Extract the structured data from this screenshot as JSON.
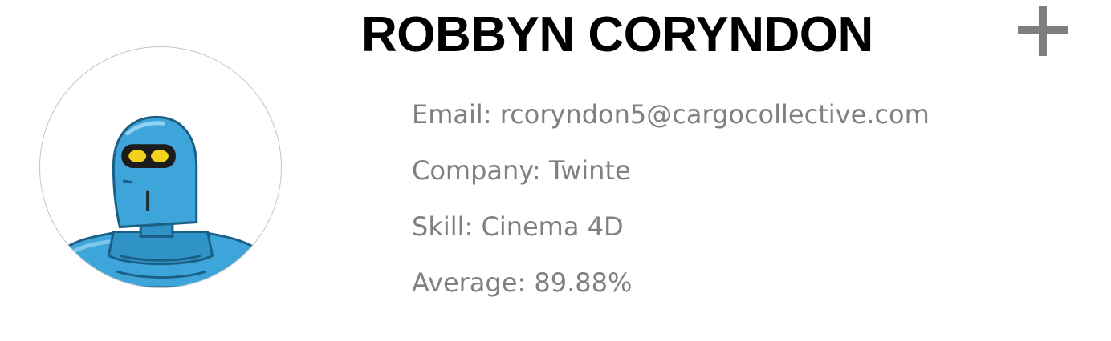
{
  "profile": {
    "name": "ROBBYN CORYNDON",
    "avatar_icon": "robot-avatar",
    "expand_icon": "plus-icon",
    "details": {
      "email": "Email: rcoryndon5@cargocollective.com",
      "company": "Company: Twinte",
      "skill": "Skill: Cinema 4D",
      "average": "Average: 89.88%"
    }
  },
  "colors": {
    "name_text": "#000000",
    "detail_text": "#808080",
    "plus_icon": "#7f7f7f",
    "avatar_border": "#c2c2c2",
    "robot_blue": "#3da5d9",
    "robot_eye": "#f2d21b"
  }
}
